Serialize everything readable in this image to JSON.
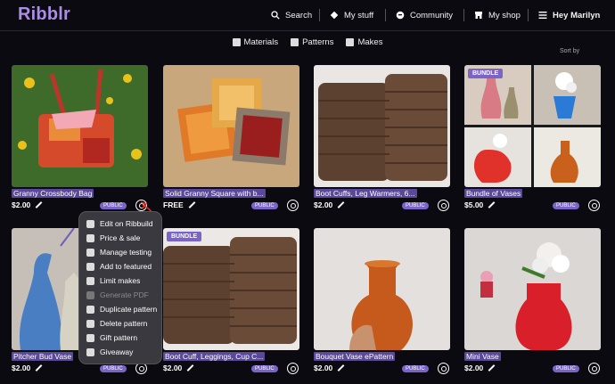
{
  "app": {
    "name": "Ribblr",
    "accent": "#a98de6"
  },
  "topnav": {
    "search": "Search",
    "mystuff": "My stuff",
    "community": "Community",
    "myshop": "My shop",
    "user": "Hey Marilyn"
  },
  "subnav": {
    "materials": "Materials",
    "patterns": "Patterns",
    "makes": "Makes"
  },
  "sort_label": "Sort by",
  "badge_public": "PUBLIC",
  "badge_bundle": "BUNDLE",
  "items": [
    {
      "title": "Granny Crossbody Bag",
      "price": "$2.00"
    },
    {
      "title": "Solid Granny Square with b...",
      "price": "FREE"
    },
    {
      "title": "Boot Cuffs, Leg Warmers, 6...",
      "price": "$2.00"
    },
    {
      "title": "Bundle of Vases",
      "price": "$5.00"
    },
    {
      "title": "Pitcher Bud Vase",
      "price": "$2.00"
    },
    {
      "title": "Boot Cuff, Leggings, Cup C...",
      "price": "$2.00"
    },
    {
      "title": "Bouquet Vase ePattern",
      "price": "$2.00"
    },
    {
      "title": "Mini Vase",
      "price": "$2.00"
    }
  ],
  "menu": [
    {
      "label": "Edit on Ribbuild",
      "icon": "edit-icon"
    },
    {
      "label": "Price & sale",
      "icon": "tag-icon"
    },
    {
      "label": "Manage testing",
      "icon": "testing-icon"
    },
    {
      "label": "Add to featured",
      "icon": "featured-icon"
    },
    {
      "label": "Limit makes",
      "icon": "limit-icon"
    },
    {
      "label": "Generate PDF",
      "icon": "pdf-icon",
      "disabled": true
    },
    {
      "label": "Duplicate pattern",
      "icon": "duplicate-icon"
    },
    {
      "label": "Delete pattern",
      "icon": "trash-icon"
    },
    {
      "label": "Gift pattern",
      "icon": "gift-icon"
    },
    {
      "label": "Giveaway",
      "icon": "giveaway-icon"
    }
  ],
  "colors": {
    "menu_bg": "#3a393f",
    "badge": "#7a64c8",
    "title_bg": "#5a4899",
    "annotation": "#e0392a"
  }
}
